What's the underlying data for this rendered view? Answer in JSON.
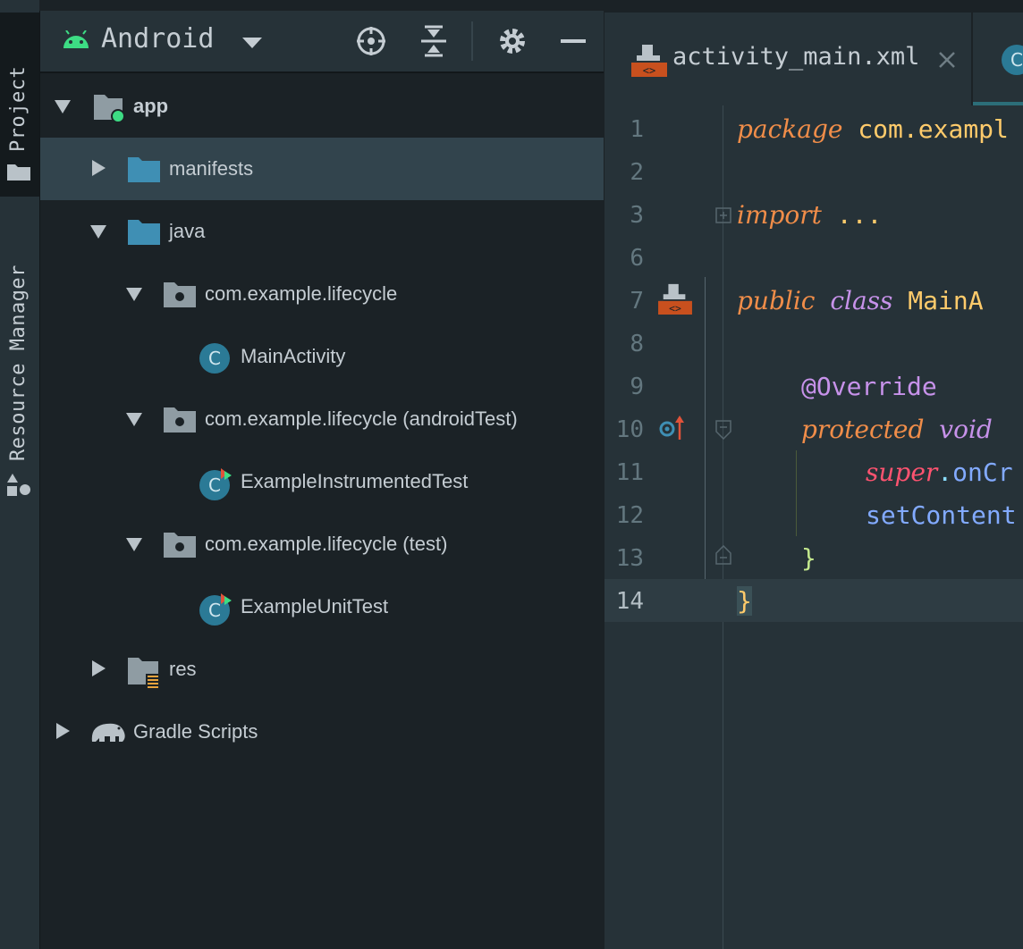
{
  "tool_strip": {
    "project_label": "Project",
    "resource_manager_label": "Resource Manager"
  },
  "project_panel": {
    "view_selector": "Android",
    "tree": [
      {
        "label": "app",
        "indent": 0,
        "expanded": true,
        "icon": "module-folder-icon",
        "bold": true
      },
      {
        "label": "manifests",
        "indent": 1,
        "expanded": false,
        "icon": "folder-icon",
        "selected": true
      },
      {
        "label": "java",
        "indent": 1,
        "expanded": true,
        "icon": "folder-icon"
      },
      {
        "label": "com.example.lifecycle",
        "indent": 2,
        "expanded": true,
        "icon": "package-icon"
      },
      {
        "label": "MainActivity",
        "indent": 3,
        "icon": "class-icon"
      },
      {
        "label": "com.example.lifecycle (androidTest)",
        "indent": 2,
        "expanded": true,
        "icon": "package-icon"
      },
      {
        "label": "ExampleInstrumentedTest",
        "indent": 3,
        "icon": "test-class-icon"
      },
      {
        "label": "com.example.lifecycle (test)",
        "indent": 2,
        "expanded": true,
        "icon": "package-icon"
      },
      {
        "label": "ExampleUnitTest",
        "indent": 3,
        "icon": "test-class-icon"
      },
      {
        "label": "res",
        "indent": 1,
        "expanded": false,
        "icon": "resource-folder-icon"
      },
      {
        "label": "Gradle Scripts",
        "indent": 0,
        "expanded": false,
        "icon": "gradle-elephant-icon"
      }
    ]
  },
  "editor": {
    "tabs": [
      {
        "label": "activity_main.xml",
        "icon": "xml-layout-icon"
      },
      {
        "label": "C",
        "icon": "class-icon"
      }
    ],
    "lines": [
      {
        "n": "1",
        "text": "package com.exampl"
      },
      {
        "n": "2",
        "text": ""
      },
      {
        "n": "3",
        "text": "import ..."
      },
      {
        "n": "6",
        "text": ""
      },
      {
        "n": "7",
        "text": "public class MainA"
      },
      {
        "n": "8",
        "text": ""
      },
      {
        "n": "9",
        "text": "@Override"
      },
      {
        "n": "10",
        "text": "protected void"
      },
      {
        "n": "11",
        "text": "super.onCr"
      },
      {
        "n": "12",
        "text": "setContent"
      },
      {
        "n": "13",
        "text": "}"
      },
      {
        "n": "14",
        "text": "}"
      }
    ],
    "current_line": "14"
  },
  "colors": {
    "accent_android_green": "#3ddc84",
    "folder_blue": "#3f8fb4",
    "class_teal": "#2b7a96",
    "keyword": "#f08d49",
    "type_keyword": "#c792ea",
    "identifier": "#ffcb6b",
    "super_red": "#ff5370",
    "method_blue": "#82aaff"
  }
}
